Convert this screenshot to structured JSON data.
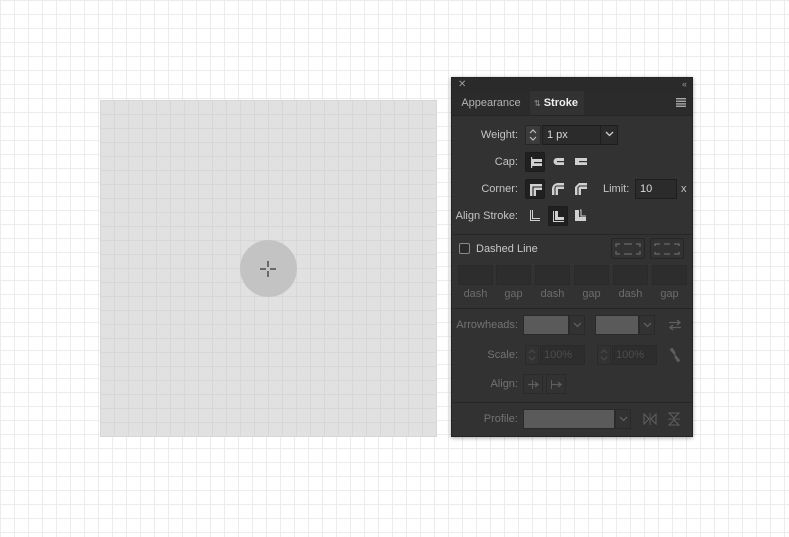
{
  "panel": {
    "close_glyph": "✕",
    "collapse_glyph": "‹‹",
    "tabs": [
      {
        "label": "Appearance"
      },
      {
        "label": "Stroke"
      }
    ]
  },
  "stroke": {
    "weight_label": "Weight:",
    "weight_value": "1 px",
    "cap_label": "Cap:",
    "corner_label": "Corner:",
    "limit_label": "Limit:",
    "limit_value": "10",
    "limit_unit": "x",
    "align_label": "Align Stroke:",
    "dashed_label": "Dashed Line",
    "dash_headers": [
      "dash",
      "gap",
      "dash",
      "gap",
      "dash",
      "gap"
    ],
    "arrowheads_label": "Arrowheads:",
    "scale_label": "Scale:",
    "scale_start": "100%",
    "scale_end": "100%",
    "align2_label": "Align:",
    "profile_label": "Profile:"
  },
  "colors": {
    "panel_bg": "#323232",
    "artboard_bg": "#e1e1e1",
    "circle_fill": "#c3c3c3"
  }
}
